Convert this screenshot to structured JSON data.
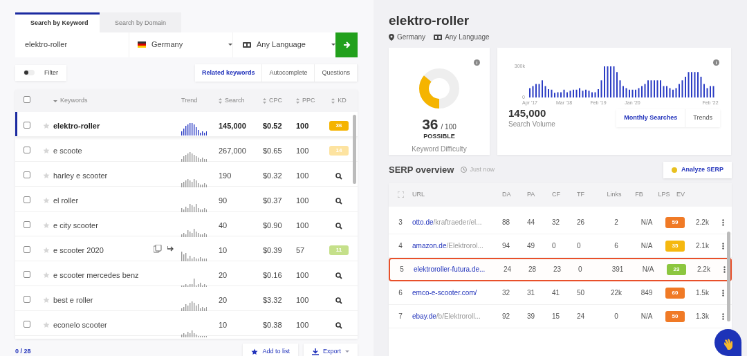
{
  "search_tabs": [
    {
      "label": "Search by Keyword",
      "selected": true
    },
    {
      "label": "Search by Domain",
      "selected": false
    }
  ],
  "search": {
    "keyword": "elektro-roller",
    "country": "Germany",
    "language": "Any Language"
  },
  "filter": {
    "label": "Filter",
    "on": false
  },
  "mode_tabs": [
    {
      "label": "Related keywords",
      "selected": true
    },
    {
      "label": "Autocomplete",
      "selected": false
    },
    {
      "label": "Questions",
      "selected": false
    }
  ],
  "select_all": {
    "checked": false
  },
  "keyword_table": {
    "columns": [
      "Keywords",
      "Trend",
      "Search",
      "CPC",
      "PPC",
      "KD"
    ],
    "rows": [
      {
        "keyword": "elektro-roller",
        "search": "145,000",
        "cpc": "$0.52",
        "ppc": "100",
        "kd": {
          "kind": "badge",
          "text": "36",
          "color": "#f5b400"
        },
        "selected": true,
        "checked": false,
        "hovered": false
      },
      {
        "keyword": "e scoote",
        "search": "267,000",
        "cpc": "$0.65",
        "ppc": "100",
        "kd": {
          "kind": "badge",
          "text": "14",
          "color": "#fde3a0"
        },
        "selected": false,
        "checked": false,
        "hovered": false
      },
      {
        "keyword": "harley e scooter",
        "search": "190",
        "cpc": "$0.32",
        "ppc": "100",
        "kd": {
          "kind": "search"
        },
        "selected": false,
        "checked": false,
        "hovered": false
      },
      {
        "keyword": "el roller",
        "search": "90",
        "cpc": "$0.37",
        "ppc": "100",
        "kd": {
          "kind": "search"
        },
        "selected": false,
        "checked": false,
        "hovered": false
      },
      {
        "keyword": "e city scooter",
        "search": "40",
        "cpc": "$0.90",
        "ppc": "100",
        "kd": {
          "kind": "search"
        },
        "selected": false,
        "checked": false,
        "hovered": false
      },
      {
        "keyword": "e scooter 2020",
        "search": "10",
        "cpc": "$0.39",
        "ppc": "57",
        "kd": {
          "kind": "badge",
          "text": "11",
          "color": "#c5e08a"
        },
        "selected": false,
        "checked": false,
        "hovered": true
      },
      {
        "keyword": "e scooter mercedes benz",
        "search": "20",
        "cpc": "$0.16",
        "ppc": "100",
        "kd": {
          "kind": "search"
        },
        "selected": false,
        "checked": false,
        "hovered": false
      },
      {
        "keyword": "best e roller",
        "search": "20",
        "cpc": "$3.32",
        "ppc": "100",
        "kd": {
          "kind": "search"
        },
        "selected": false,
        "checked": false,
        "hovered": false
      },
      {
        "keyword": "econelo scooter",
        "search": "10",
        "cpc": "$0.38",
        "ppc": "100",
        "kd": {
          "kind": "search"
        },
        "selected": false,
        "checked": false,
        "hovered": false
      }
    ]
  },
  "selection_count": "0 / 28",
  "footer_buttons": [
    "Add to list",
    "Export"
  ],
  "detail": {
    "keyword": "elektro-roller",
    "country": "Germany",
    "language": "Any Language"
  },
  "difficulty": {
    "score": "36",
    "max": "/ 100",
    "rating": "POSSIBLE",
    "label": "Keyword Difficulty",
    "level": 0.36
  },
  "volume": {
    "chart_data": {
      "type": "bar",
      "categories": [
        "Apr '17",
        null,
        null,
        null,
        null,
        null,
        null,
        null,
        null,
        null,
        null,
        "Mar '18",
        null,
        null,
        null,
        null,
        null,
        null,
        null,
        null,
        null,
        null,
        "Feb '19",
        null,
        null,
        null,
        null,
        null,
        null,
        null,
        null,
        null,
        null,
        "Jan '20",
        null,
        null,
        null,
        null,
        null,
        null,
        null,
        null,
        null,
        null,
        null,
        null,
        null,
        null,
        null,
        null,
        null,
        null,
        null,
        null,
        null,
        null,
        null,
        null,
        "Feb '22",
        null
      ],
      "ylim": [
        0,
        300
      ],
      "yticks": [
        {
          "value": 0,
          "label": "0"
        },
        {
          "value": 300,
          "label": "300k"
        }
      ],
      "series": [
        {
          "color": "#2b3cc4",
          "values": [
            90,
            110,
            130,
            130,
            165,
            110,
            80,
            75,
            45,
            50,
            50,
            75,
            50,
            65,
            75,
            75,
            90,
            65,
            75,
            65,
            50,
            50,
            80,
            165,
            300,
            300,
            300,
            300,
            245,
            165,
            110,
            90,
            75,
            75,
            75,
            90,
            110,
            130,
            165,
            165,
            165,
            165,
            165,
            110,
            110,
            90,
            75,
            90,
            130,
            165,
            200,
            245,
            245,
            245,
            245,
            200,
            130,
            90,
            110,
            110
          ]
        }
      ]
    },
    "total": "145,000",
    "label": "Search Volume",
    "view_tabs": [
      {
        "label": "Monthly Searches",
        "selected": true
      },
      {
        "label": "Trends",
        "selected": false
      }
    ]
  },
  "serp": {
    "title": "SERP overview",
    "updated": "Just now",
    "analyze_button": "Analyze SERP",
    "columns": [
      "URL",
      "DA",
      "PA",
      "CF",
      "TF",
      "Links",
      "FB",
      "LPS",
      "EV"
    ],
    "rows": [
      {
        "rank": "3",
        "domain": "otto.de",
        "path": "/kraftraeder/el...",
        "da": "88",
        "pa": "44",
        "cf": "32",
        "tf": "26",
        "links": "2",
        "fb": "N/A",
        "lps": {
          "text": "59",
          "color": "#f07a26"
        },
        "ev": "2.2k",
        "highlighted": false
      },
      {
        "rank": "4",
        "domain": "amazon.de",
        "path": "/Elektrorol...",
        "da": "94",
        "pa": "49",
        "cf": "0",
        "tf": "0",
        "links": "6",
        "fb": "N/A",
        "lps": {
          "text": "35",
          "color": "#f5b80f"
        },
        "ev": "2.1k",
        "highlighted": false
      },
      {
        "rank": "5",
        "domain": "elektroroller-futura.de...",
        "da": "24",
        "pa": "28",
        "cf": "23",
        "tf": "0",
        "links": "391",
        "fb": "N/A",
        "lps": {
          "text": "23",
          "color": "#8cc63f"
        },
        "ev": "2.2k",
        "highlighted": true
      },
      {
        "rank": "6",
        "domain": "emco-e-scooter.com/",
        "da": "32",
        "pa": "31",
        "cf": "41",
        "tf": "50",
        "links": "22k",
        "fb": "849",
        "lps": {
          "text": "60",
          "color": "#f07a26"
        },
        "ev": "1.5k",
        "highlighted": false
      },
      {
        "rank": "7",
        "domain": "ebay.de",
        "path": "/b/Elektroroll...",
        "da": "92",
        "pa": "39",
        "cf": "15",
        "tf": "24",
        "links": "0",
        "fb": "N/A",
        "lps": {
          "text": "50",
          "color": "#f07a26"
        },
        "ev": "1.3k",
        "highlighted": false
      }
    ]
  }
}
